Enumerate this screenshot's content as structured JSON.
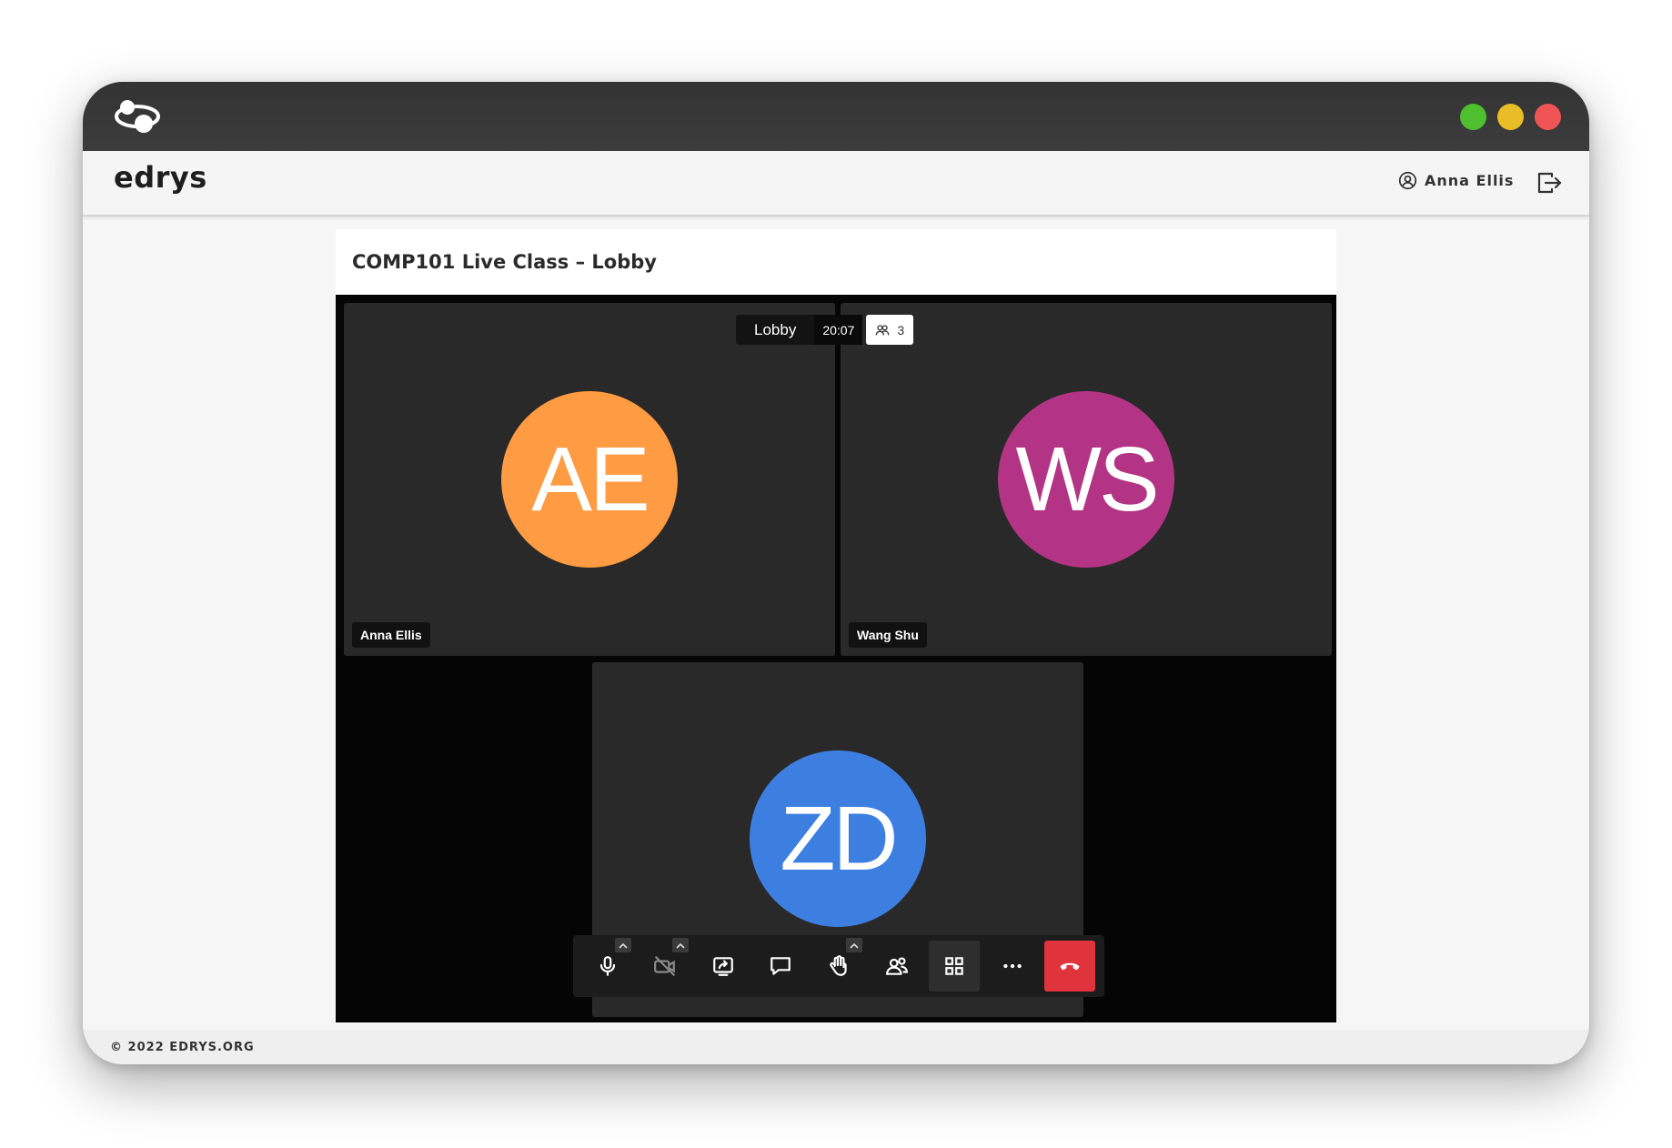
{
  "window": {
    "logo_icon": "edrys-logo-icon",
    "controls": [
      "maximize",
      "minimize",
      "close"
    ]
  },
  "header": {
    "brand": "edrys",
    "user_name": "Anna Ellis",
    "user_icon": "user-circle-icon",
    "logout_icon": "logout-icon"
  },
  "page": {
    "title": "COMP101 Live Class – Lobby"
  },
  "meeting": {
    "room_name": "Lobby",
    "duration": "20:07",
    "participant_count": "3",
    "participants": [
      {
        "initials": "AE",
        "name": "Anna Ellis",
        "color": "#ff9b42"
      },
      {
        "initials": "WS",
        "name": "Wang Shu",
        "color": "#b33484"
      },
      {
        "initials": "ZD",
        "name": "",
        "color": "#3d7fe0"
      }
    ]
  },
  "toolbar": {
    "buttons": [
      "microphone",
      "camera-off",
      "screen-share",
      "chat",
      "raise-hand",
      "participants",
      "tile-view",
      "more",
      "hang-up"
    ],
    "hangup_color": "#e0343d"
  },
  "footer": {
    "copyright": "© 2022 EDRYS.ORG"
  }
}
